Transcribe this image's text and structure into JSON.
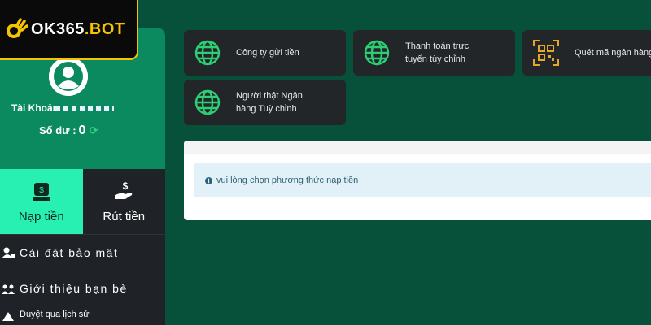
{
  "brand": {
    "prefix": "OK365",
    "suffix": ".BOT"
  },
  "profile": {
    "account_label": "Tài Khoản",
    "balance_label": "Số dư :",
    "balance_value": "0"
  },
  "actions": {
    "deposit_label": "Nạp tiền",
    "withdraw_label": "Rút tiền"
  },
  "menu": [
    {
      "label": "Cài đặt bảo mật",
      "icon": "user-lock-icon"
    },
    {
      "label": "Giới thiệu bạn bè",
      "icon": "friends-icon"
    },
    {
      "label": "Duyệt qua lịch sử",
      "icon": "history-icon"
    }
  ],
  "methods": [
    {
      "label": "Công ty gửi tiền",
      "icon": "globe-icon"
    },
    {
      "label_line1": "Thanh toán trực",
      "label_line2": "tuyến tùy chỉnh",
      "icon": "globe-icon"
    },
    {
      "label": "Quét mã ngân hàng",
      "icon": "qr-scan-icon"
    },
    {
      "label_line1": "Người thật Ngân",
      "label_line2": "hàng Tuỳ chỉnh",
      "icon": "globe-icon"
    }
  ],
  "notice": {
    "text": "vui lòng chọn phương thức nạp tiền"
  },
  "colors": {
    "accent": "#28f0b2",
    "page_bg": "#075039",
    "profile_bg": "#0b8a5f",
    "card_bg": "#232629",
    "logo_gold": "#f5c400"
  }
}
